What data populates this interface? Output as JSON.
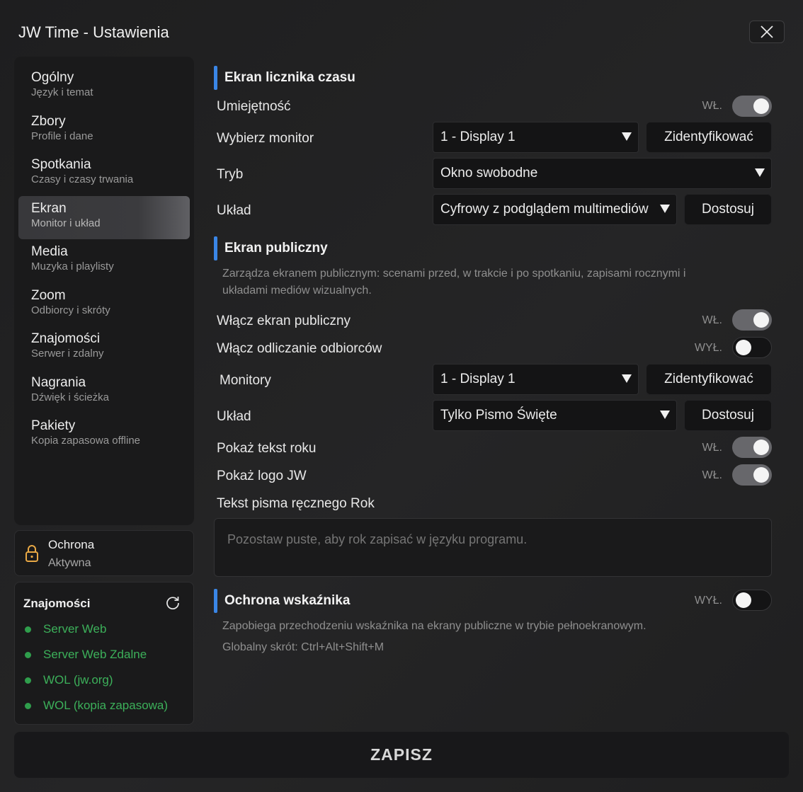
{
  "window": {
    "title": "JW Time - Ustawienia"
  },
  "sidebar": {
    "items": [
      {
        "title": "Ogólny",
        "sub": "Język i temat"
      },
      {
        "title": "Zbory",
        "sub": "Profile i dane"
      },
      {
        "title": "Spotkania",
        "sub": "Czasy i czasy trwania"
      },
      {
        "title": "Ekran",
        "sub": "Monitor i układ"
      },
      {
        "title": "Media",
        "sub": "Muzyka i playlisty"
      },
      {
        "title": "Zoom",
        "sub": "Odbiorcy i skróty"
      },
      {
        "title": "Znajomości",
        "sub": "Serwer i zdalny"
      },
      {
        "title": "Nagrania",
        "sub": "Dźwięk i ścieżka"
      },
      {
        "title": "Pakiety",
        "sub": "Kopia zapasowa offline"
      }
    ],
    "active_index": 3
  },
  "protection": {
    "title": "Ochrona",
    "status": "Aktywna"
  },
  "connections": {
    "title": "Znajomości",
    "items": [
      "Server Web",
      "Server Web Zdalne",
      "WOL (jw.org)",
      "WOL (kopia zapasowa)"
    ],
    "status_color": "#2f9e4c"
  },
  "timer_screen": {
    "title": "Ekran licznika czasu",
    "skill_label": "Umiejętność",
    "skill_state": "WŁ.",
    "monitor_label": "Wybierz monitor",
    "monitor_value": "1 - Display 1",
    "identify_label": "Zidentyfikować",
    "mode_label": "Tryb",
    "mode_value": "Okno swobodne",
    "layout_label": "Układ",
    "layout_value": "Cyfrowy z podglądem multimediów",
    "customize_label": "Dostosuj"
  },
  "public_screen": {
    "title": "Ekran publiczny",
    "description": "Zarządza ekranem publicznym: scenami przed, w trakcie i po spotkaniu, zapisami rocznymi i układami mediów wizualnych.",
    "enable_label": "Włącz ekran publiczny",
    "enable_state": "WŁ.",
    "countdown_label": "Włącz odliczanie odbiorców",
    "countdown_state": "WYŁ.",
    "monitors_label": "Monitory",
    "monitors_value": "1 - Display 1",
    "identify_label": "Zidentyfikować",
    "layout_label": "Układ",
    "layout_value": "Tylko Pismo Święte",
    "customize_label": "Dostosuj",
    "year_text_label": "Pokaż tekst roku",
    "year_text_state": "WŁ.",
    "jw_logo_label": "Pokaż logo JW",
    "jw_logo_state": "WŁ.",
    "manual_year_label": "Tekst pisma ręcznego Rok",
    "manual_year_placeholder": "Pozostaw puste, aby rok zapisać w języku programu."
  },
  "pointer_protection": {
    "title": "Ochrona wskaźnika",
    "state": "WYŁ.",
    "description": "Zapobiega przechodzeniu wskaźnika na ekrany publiczne w trybie pełnoekranowym.",
    "shortcut": "Globalny skrót: Ctrl+Alt+Shift+M"
  },
  "footer": {
    "save_label": "ZAPISZ"
  },
  "colors": {
    "accent": "#3a86e6",
    "connection_ok": "#3cb05a",
    "toggle_on": "#67676b"
  }
}
